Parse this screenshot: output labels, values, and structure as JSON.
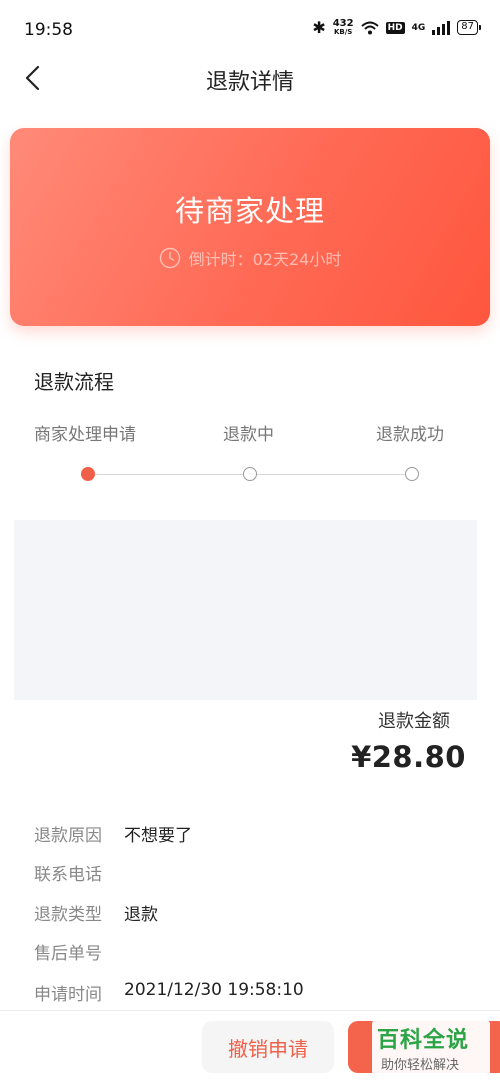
{
  "status_bar": {
    "time": "19:58",
    "net_speed_value": "432",
    "net_speed_unit": "KB/S",
    "hd_label": "HD",
    "network_label": "4G",
    "battery": "87"
  },
  "nav": {
    "title": "退款详情"
  },
  "status_card": {
    "status": "待商家处理",
    "countdown": "倒计时：02天24小时",
    "colors": {
      "from": "#ff8a78",
      "to": "#ff563e"
    }
  },
  "flow": {
    "title": "退款流程",
    "steps": [
      {
        "label": "商家处理申请",
        "active": true
      },
      {
        "label": "退款中",
        "active": false
      },
      {
        "label": "退款成功",
        "active": false
      }
    ]
  },
  "amount": {
    "label": "退款金额",
    "value": "¥28.80"
  },
  "details": [
    {
      "key": "退款原因",
      "value": "不想要了"
    },
    {
      "key": "联系电话",
      "value": ""
    },
    {
      "key": "退款类型",
      "value": "退款"
    },
    {
      "key": "售后单号",
      "value": ""
    },
    {
      "key": "申请时间",
      "value": "2021/12/30 19:58:10"
    }
  ],
  "actions": {
    "cancel_label": "撤销申请",
    "accent": "#f06049"
  },
  "watermark": {
    "main": "百科全说",
    "sub": "助你轻松解决"
  }
}
